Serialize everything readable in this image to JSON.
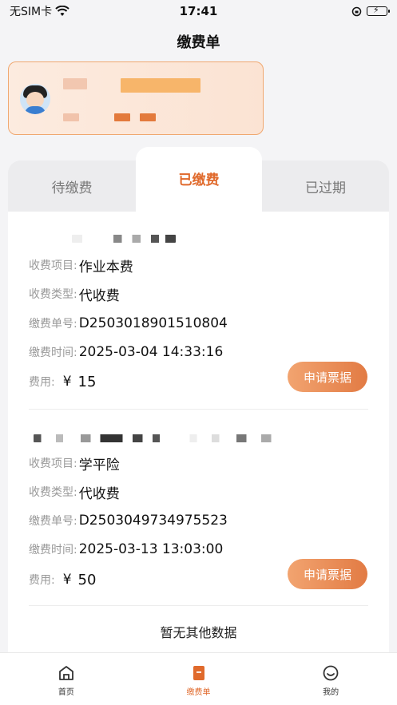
{
  "status_bar": {
    "carrier": "无SIM卡",
    "time": "17:41"
  },
  "header": {
    "title": "缴费单"
  },
  "tabs": [
    {
      "label": "待缴费"
    },
    {
      "label": "已缴费"
    },
    {
      "label": "已过期"
    }
  ],
  "labels": {
    "item": "收费项目:",
    "type": "收费类型:",
    "order_no": "缴费单号:",
    "time": "缴费时间:",
    "fee": "费用:",
    "currency": "¥"
  },
  "records": [
    {
      "item": "作业本费",
      "type": "代收费",
      "order_no": "D2503018901510804",
      "time": "2025-03-04 14:33:16",
      "fee": "15",
      "button": "申请票据"
    },
    {
      "item": "学平险",
      "type": "代收费",
      "order_no": "D2503049734975523",
      "time": "2025-03-13 13:03:00",
      "fee": "50",
      "button": "申请票据"
    }
  ],
  "no_more": "暂无其他数据",
  "tabbar": [
    {
      "label": "首页",
      "icon": "home-icon"
    },
    {
      "label": "缴费单",
      "icon": "bill-icon"
    },
    {
      "label": "我的",
      "icon": "smile-icon"
    }
  ],
  "colors": {
    "accent": "#e06a2c",
    "button_gradient_start": "#f2a470",
    "button_gradient_end": "#e27b44"
  }
}
